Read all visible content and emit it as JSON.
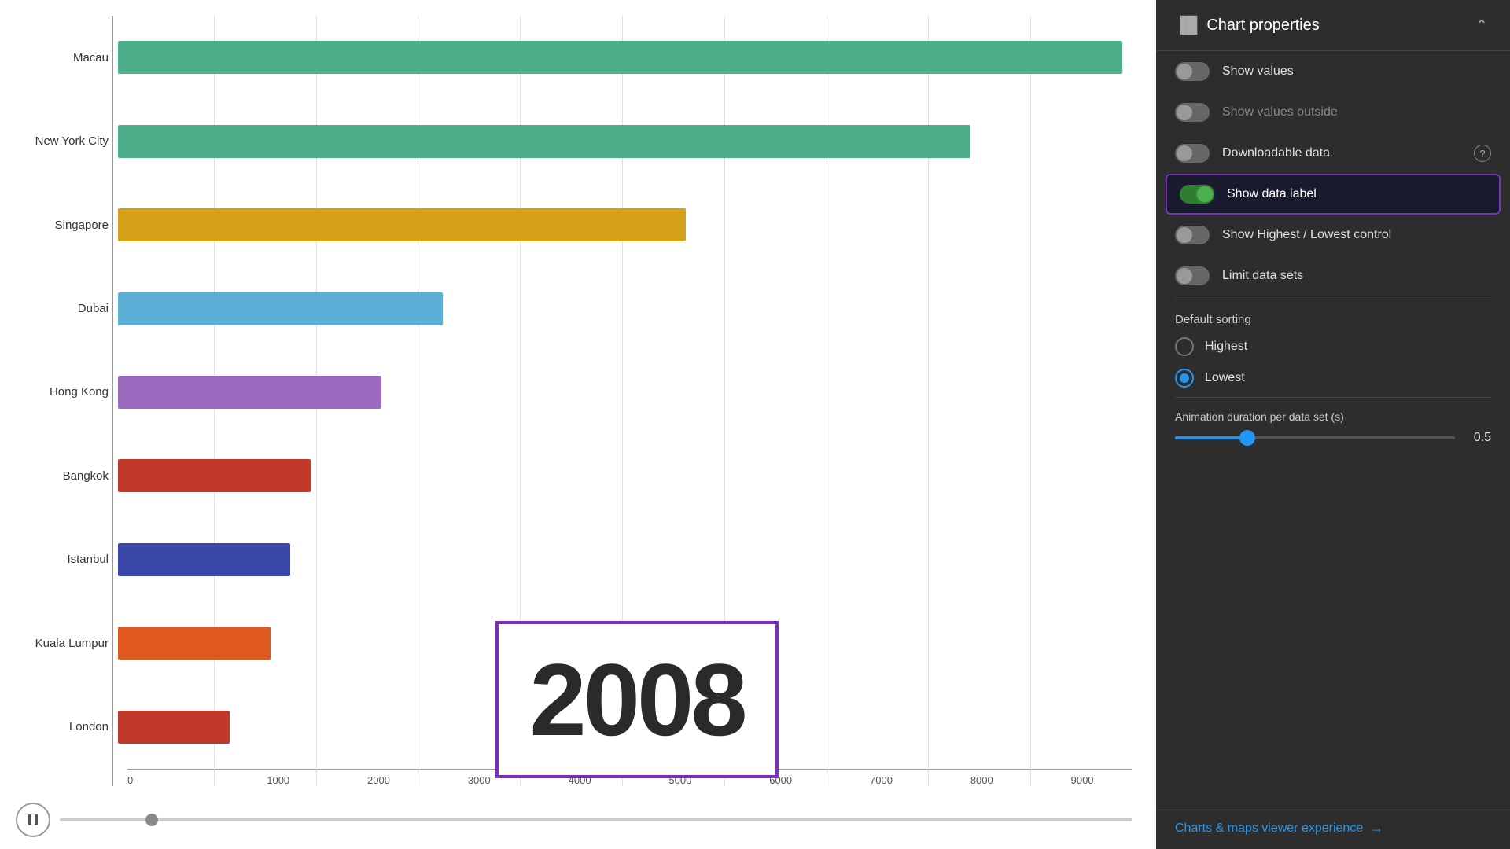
{
  "panel": {
    "title": "Chart properties",
    "collapse_label": "^"
  },
  "toggles": {
    "show_values": {
      "label": "Show values",
      "state": false
    },
    "show_values_outside": {
      "label": "Show values outside",
      "state": false,
      "dimmed": true
    },
    "downloadable_data": {
      "label": "Downloadable data",
      "state": false
    },
    "show_data_label": {
      "label": "Show data label",
      "state": true,
      "highlighted": true
    },
    "show_highest_lowest": {
      "label": "Show Highest / Lowest control",
      "state": false
    },
    "limit_data_sets": {
      "label": "Limit data sets",
      "state": false
    }
  },
  "sorting": {
    "section_label": "Default sorting",
    "options": [
      {
        "label": "Highest",
        "selected": false
      },
      {
        "label": "Lowest",
        "selected": true
      }
    ]
  },
  "animation": {
    "label": "Animation duration per data set (s)",
    "value": "0.5",
    "fill_pct": 25
  },
  "bottom_link": {
    "text": "Charts & maps viewer experience",
    "icon": "→"
  },
  "chart": {
    "year": "2008",
    "bars": [
      {
        "label": "Macau",
        "value": 9900,
        "color": "#4caf8a",
        "max_value": 10000
      },
      {
        "label": "New York City",
        "value": 8400,
        "color": "#4caf8a",
        "max_value": 10000
      },
      {
        "label": "Singapore",
        "value": 5600,
        "color": "#d4a017",
        "max_value": 10000
      },
      {
        "label": "Dubai",
        "value": 3200,
        "color": "#5bafd6",
        "max_value": 10000
      },
      {
        "label": "Hong Kong",
        "value": 2600,
        "color": "#9c6bbf",
        "max_value": 10000
      },
      {
        "label": "Bangkok",
        "value": 1900,
        "color": "#c0392b",
        "max_value": 10000
      },
      {
        "label": "Istanbul",
        "value": 1700,
        "color": "#3a47a8",
        "max_value": 10000
      },
      {
        "label": "Kuala Lumpur",
        "value": 1500,
        "color": "#e05a20",
        "max_value": 10000
      },
      {
        "label": "London",
        "value": 1100,
        "color": "#c0392b",
        "max_value": 10000
      }
    ],
    "x_ticks": [
      "0",
      "1000",
      "2000",
      "3000",
      "4000",
      "5000",
      "6000",
      "7000",
      "8000",
      "9000"
    ]
  },
  "playback": {
    "pause_label": "⏸"
  }
}
